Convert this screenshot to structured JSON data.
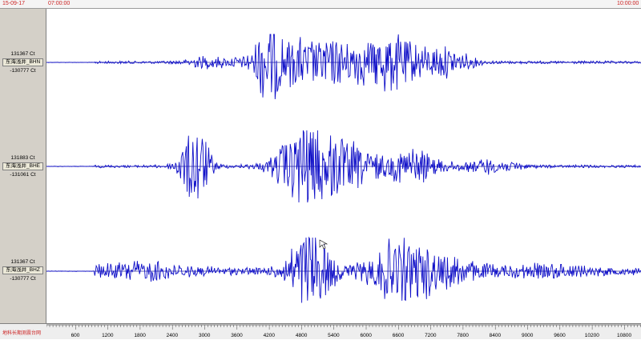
{
  "header": {
    "date_label": "15-09-17",
    "start_time": "07:00:00",
    "end_time": "10:00:00"
  },
  "channels": [
    {
      "max_label": "131367 Ct",
      "name": "东海浅井_BHN",
      "min_label": "-130777 Ct"
    },
    {
      "max_label": "131883 Ct",
      "name": "东海浅井_BHE",
      "min_label": "-131061 Ct"
    },
    {
      "max_label": "131367 Ct",
      "name": "东海浅井_BHZ",
      "min_label": "-130777 Ct"
    }
  ],
  "footer": {
    "org_label": "地科长期测震台网"
  },
  "time_axis": {
    "ticks": [
      "600",
      "1200",
      "1800",
      "2400",
      "3000",
      "3600",
      "4200",
      "4800",
      "5400",
      "6000",
      "6600",
      "7200",
      "7800",
      "8400",
      "9000",
      "9600",
      "10200",
      "10800"
    ]
  },
  "colors": {
    "trace": "#1010c8",
    "header_text": "#cc2222",
    "panel_bg": "#d4d0c8"
  }
}
